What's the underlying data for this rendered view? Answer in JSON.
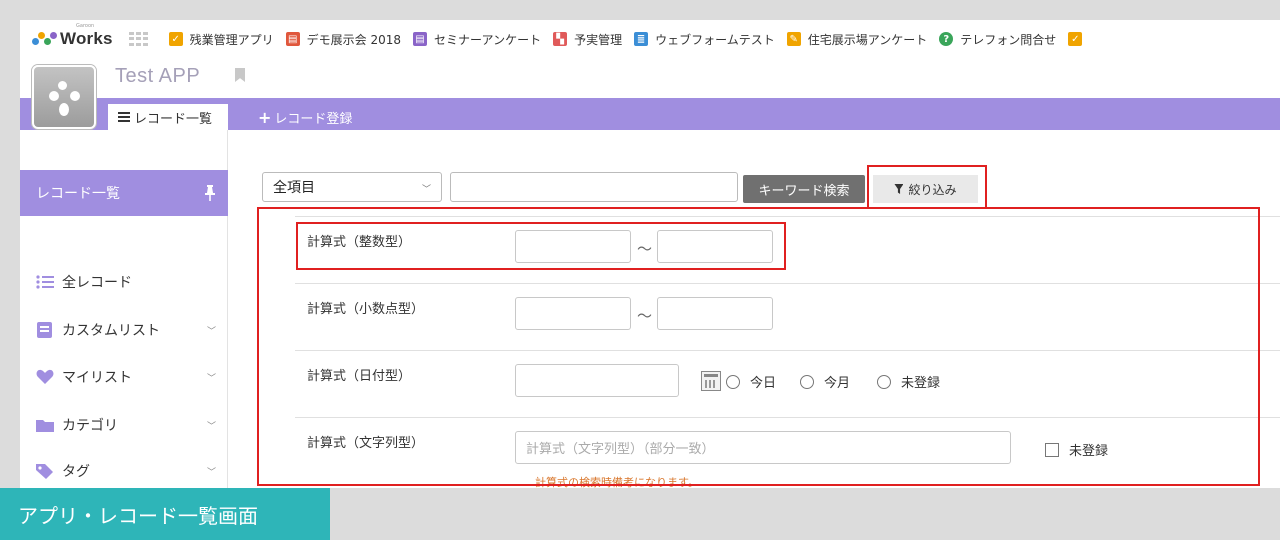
{
  "brand": {
    "name": "Works",
    "small": "Garoon"
  },
  "top_apps": [
    {
      "label": "残業管理アプリ",
      "color": "#f0a400",
      "icon": "check-icon"
    },
    {
      "label": "デモ展示会 2018",
      "color": "#e0573c",
      "icon": "doc-icon"
    },
    {
      "label": "セミナーアンケート",
      "color": "#8a64c8",
      "icon": "doc-icon"
    },
    {
      "label": "予実管理",
      "color": "#e05a5a",
      "icon": "chart-icon"
    },
    {
      "label": "ウェブフォームテスト",
      "color": "#3b8ed6",
      "icon": "form-icon"
    },
    {
      "label": "住宅展示場アンケート",
      "color": "#f0a400",
      "icon": "note-icon"
    },
    {
      "label": "テレフォン問合せ",
      "color": "#3aa55a",
      "icon": "question-icon"
    }
  ],
  "app": {
    "title": "Test APP"
  },
  "tabs": {
    "list": "レコード一覧",
    "register": "レコード登録"
  },
  "sidebar": {
    "main": "レコード一覧",
    "items": [
      {
        "label": "全レコード",
        "color": "#a08ee0"
      },
      {
        "label": "カスタムリスト",
        "color": "#a08ee0"
      },
      {
        "label": "マイリスト",
        "color": "#a08ee0"
      },
      {
        "label": "カテゴリ",
        "color": "#a08ee0"
      },
      {
        "label": "タグ",
        "color": "#a08ee0"
      }
    ]
  },
  "search": {
    "field": "全項目",
    "keyword_button": "キーワード検索",
    "filter_tab": "絞り込み"
  },
  "filters": {
    "int_label": "計算式（整数型）",
    "decimal_label": "計算式（小数点型）",
    "date_label": "計算式（日付型）",
    "text_label": "計算式（文字列型）",
    "range_sep": "〜",
    "radio_today": "今日",
    "radio_month": "今月",
    "radio_none": "未登録",
    "text_placeholder": "計算式（文字列型）（部分一致）",
    "checkbox_none": "未登録",
    "helper": "計算式の検索時備考になります。"
  },
  "caption": "アプリ・レコード一覧画面"
}
